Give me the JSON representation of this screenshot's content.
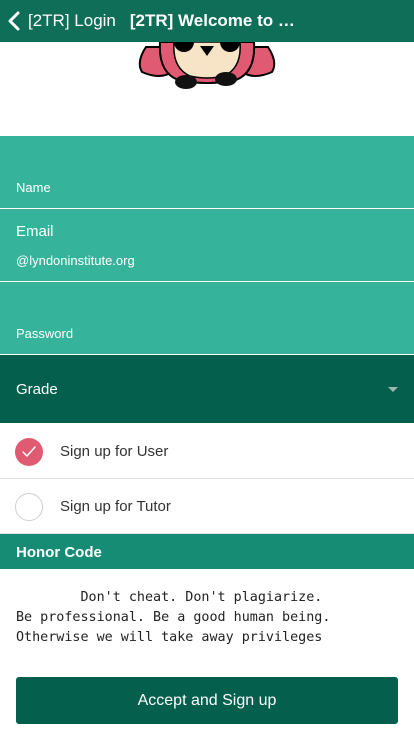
{
  "nav": {
    "back_label": "[2TR] Login",
    "title": "[2TR] Welcome to 2..."
  },
  "hero": {
    "image": "owl-mascot"
  },
  "form": {
    "name_label": "Name",
    "email_label": "Email",
    "email_hint": "@lyndoninstitute.org",
    "password_label": "Password",
    "grade_label": "Grade"
  },
  "signup_options": [
    {
      "label": "Sign up for User",
      "selected": true
    },
    {
      "label": "Sign up for Tutor",
      "selected": false
    }
  ],
  "honor_code": {
    "title": "Honor Code",
    "text": "        Don't cheat. Don't plagiarize.\nBe professional. Be a good human being.\nOtherwise we will take away privileges"
  },
  "accept_button": "Accept and Sign up",
  "colors": {
    "nav": "#0f6e58",
    "field": "#36b49b",
    "dark": "#045f4d",
    "accent": "#e05a72"
  }
}
